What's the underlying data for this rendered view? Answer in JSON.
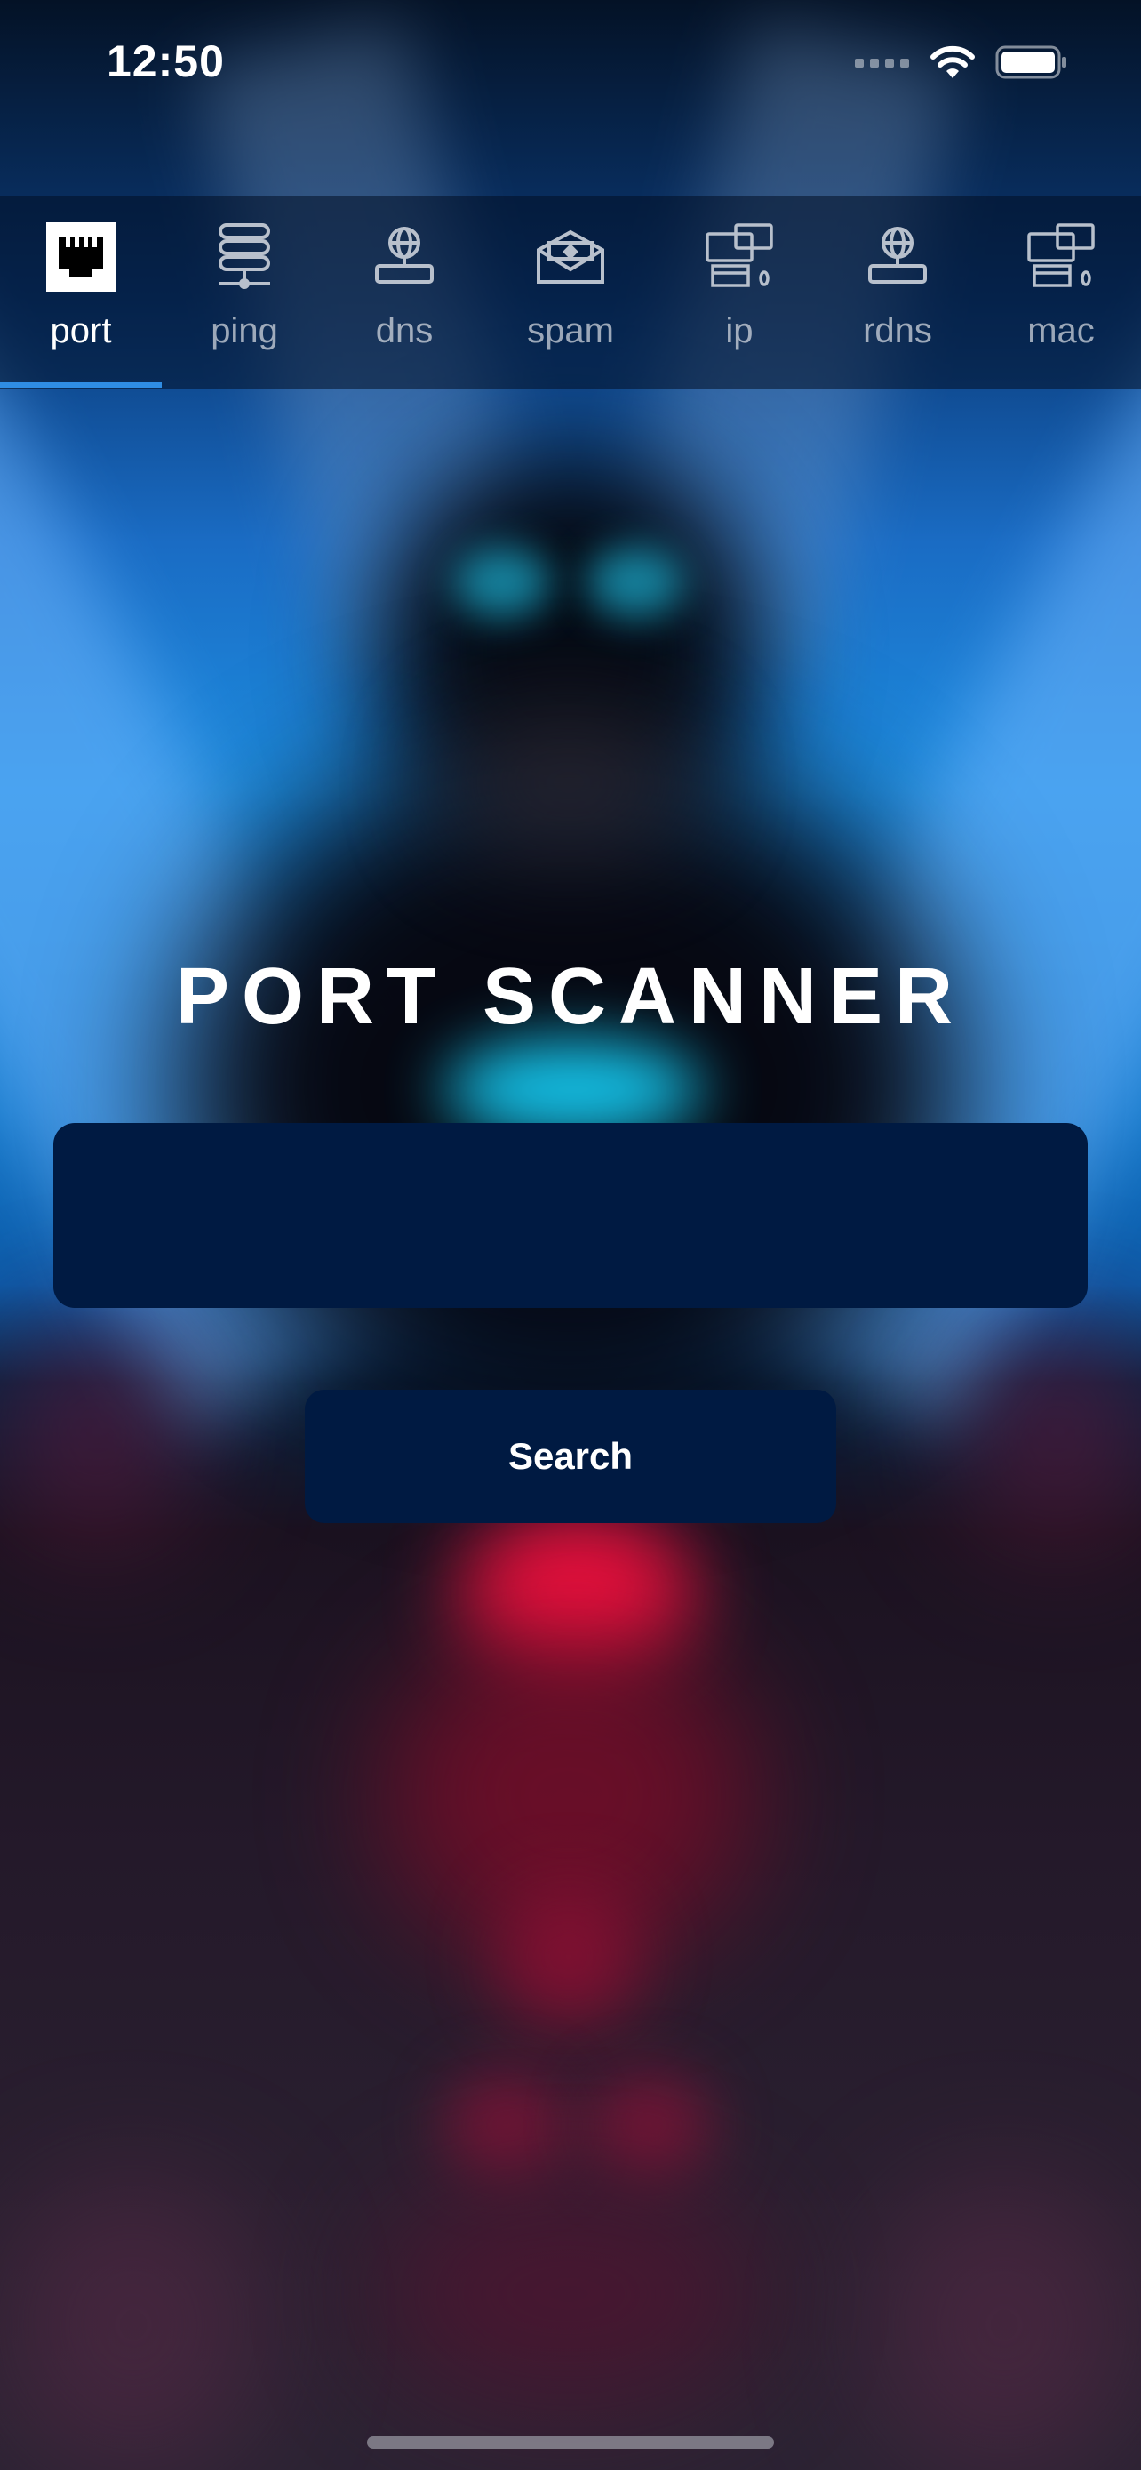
{
  "status_bar": {
    "time": "12:50"
  },
  "tabs": [
    {
      "label": "port",
      "icon": "ethernet-port-icon",
      "active": true
    },
    {
      "label": "ping",
      "icon": "server-stack-icon",
      "active": false
    },
    {
      "label": "dns",
      "icon": "globe-network-icon",
      "active": false
    },
    {
      "label": "spam",
      "icon": "mail-envelope-icon",
      "active": false
    },
    {
      "label": "ip",
      "icon": "computers-icon",
      "active": false
    },
    {
      "label": "rdns",
      "icon": "globe-network-icon",
      "active": false
    },
    {
      "label": "mac",
      "icon": "computers-icon",
      "active": false
    }
  ],
  "main": {
    "title": "PORT SCANNER",
    "input_value": "",
    "search_label": "Search"
  },
  "colors": {
    "accent": "#2f8de4",
    "field_bg": "#001a42",
    "text": "#ffffff",
    "inactive_text": "#9aa4b4"
  }
}
